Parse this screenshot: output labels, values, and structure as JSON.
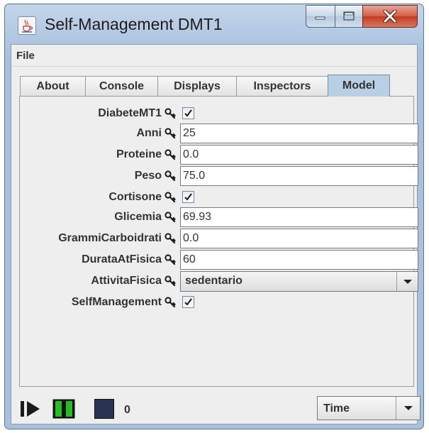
{
  "window": {
    "title": "Self-Management DMT1"
  },
  "menu": {
    "file": "File"
  },
  "tabs": [
    {
      "label": "About",
      "active": false
    },
    {
      "label": "Console",
      "active": false
    },
    {
      "label": "Displays",
      "active": false
    },
    {
      "label": "Inspectors",
      "active": false
    },
    {
      "label": "Model",
      "active": true
    }
  ],
  "properties": {
    "diabete": {
      "label": "DiabeteMT1",
      "checked": true
    },
    "anni": {
      "label": "Anni",
      "value": "25"
    },
    "proteine": {
      "label": "Proteine",
      "value": "0.0"
    },
    "peso": {
      "label": "Peso",
      "value": "75.0"
    },
    "cortisone": {
      "label": "Cortisone",
      "checked": true
    },
    "glicemia": {
      "label": "Glicemia",
      "value": "69.93"
    },
    "grammi": {
      "label": "GrammiCarboidrati",
      "value": "0.0"
    },
    "durata": {
      "label": "DurataAtFisica",
      "value": "60"
    },
    "attivita": {
      "label": "AttivitaFisica",
      "value": "sedentario"
    },
    "selfmgmt": {
      "label": "SelfManagement",
      "checked": true
    }
  },
  "controls": {
    "step_count": "0",
    "time_mode": "Time"
  },
  "icons": {
    "app": "java-cup-icon",
    "property": "key-icon",
    "play": "step-play-icon",
    "pause": "pause-icon",
    "stop": "stop-icon"
  },
  "colors": {
    "pause_green": "#22c022",
    "stop_navy": "#2a3350",
    "close_red": "#c8452b",
    "active_tab": "#b8cfe5"
  }
}
